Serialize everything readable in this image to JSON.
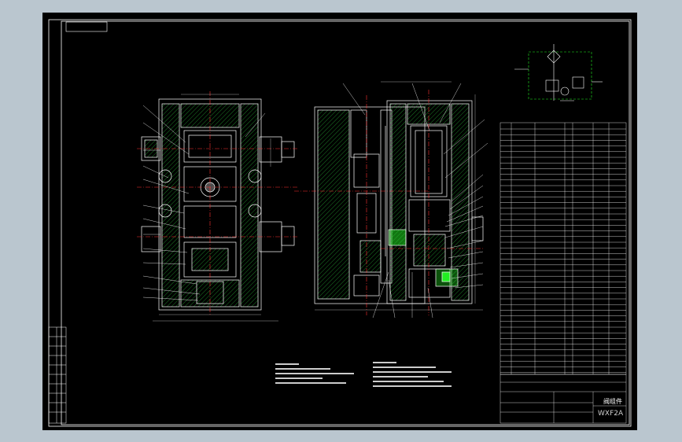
{
  "viewport": {
    "background": "#000000",
    "frame_color": "#ffffff"
  },
  "title_block": {
    "drawing_name": "阀组件",
    "drawing_code": "WXF2A"
  },
  "colors": {
    "outline": "#ffffff",
    "hatch": "#2ecc40",
    "centerline": "#ff3333",
    "highlight": "#22ee22",
    "dim": "#cccccc"
  }
}
